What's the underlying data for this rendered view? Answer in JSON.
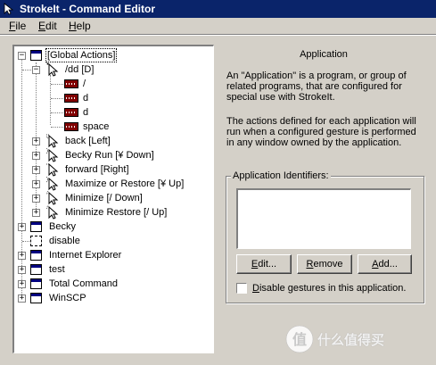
{
  "window": {
    "title": "StrokeIt - Command Editor"
  },
  "menu": [
    {
      "label": "File"
    },
    {
      "label": "Edit"
    },
    {
      "label": "Help"
    }
  ],
  "tree": {
    "global_actions": "[Global Actions]",
    "dd": "/dd [D]",
    "keys": [
      "/",
      "d",
      "d",
      "space"
    ],
    "gestures": [
      "back [Left]",
      "Becky Run [¥ Down]",
      "forward [Right]",
      "Maximize or Restore [¥ Up]",
      "Minimize [/ Down]",
      "Minimize Restore  [/ Up]"
    ],
    "apps": [
      "Becky",
      "disable",
      "Internet Explorer",
      "test",
      "Total Command",
      "WinSCP"
    ]
  },
  "panel": {
    "title": "Application",
    "desc1": "An \"Application\" is a program, or group of related programs, that are configured for special use with StrokeIt.",
    "desc2": "The actions defined for each application will run when a configured gesture is performed in any window owned by the application.",
    "group_title": "Application Identifiers:",
    "edit_button": "Edit...",
    "remove_button": "Remove",
    "add_button": "Add...",
    "checkbox_label": "Disable gestures in this application.",
    "checkbox_checked": false
  },
  "watermark": {
    "text": "什么值得买"
  },
  "colors": {
    "titlebar": "#0a246a",
    "face": "#d4d0c8",
    "selection": "#000080"
  }
}
